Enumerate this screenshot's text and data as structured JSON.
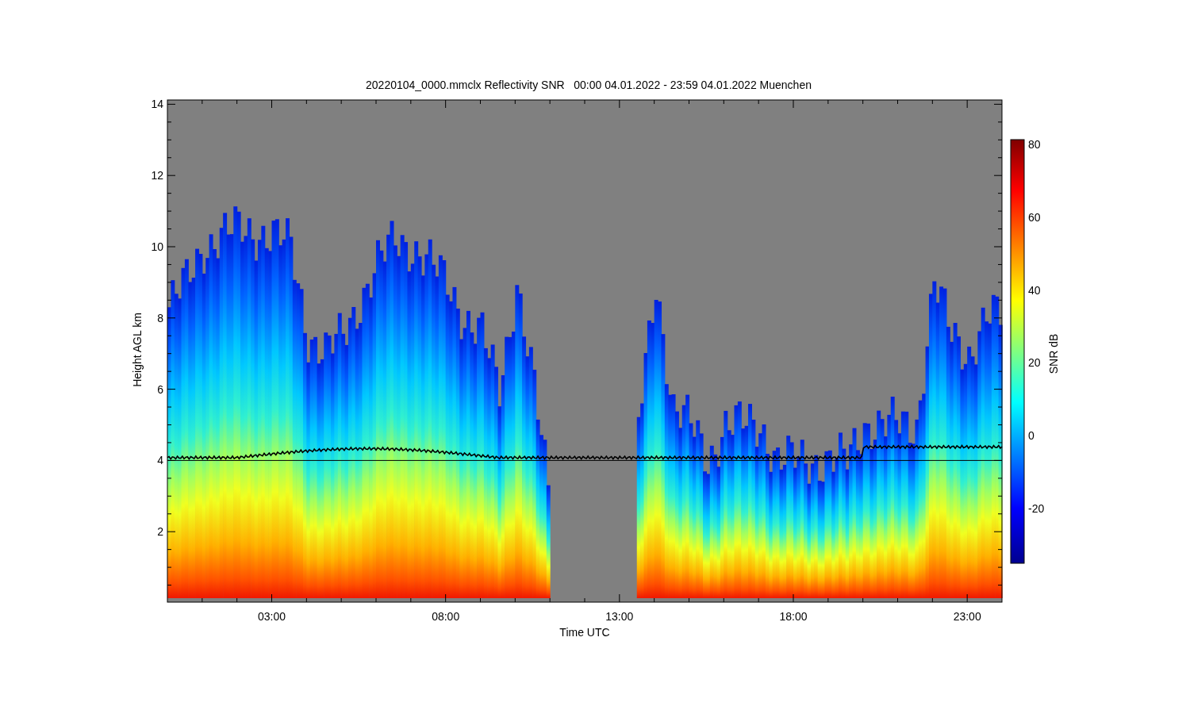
{
  "title": "20220104_0000.mmclx Reflectivity SNR   00:00 04.01.2022 - 23:59 04.01.2022 Muenchen",
  "plot": {
    "ylabel": "Height AGL km",
    "xlabel": "Time UTC",
    "yticks": [
      "14",
      "12",
      "10",
      "8",
      "6",
      "4",
      "2"
    ],
    "xticks": [
      "03:00",
      "08:00",
      "13:00",
      "18:00",
      "23:00"
    ]
  },
  "colorbar": {
    "label": "SNR dB",
    "ticks": [
      "80",
      "60",
      "40",
      "20",
      "0",
      "-20"
    ]
  }
}
